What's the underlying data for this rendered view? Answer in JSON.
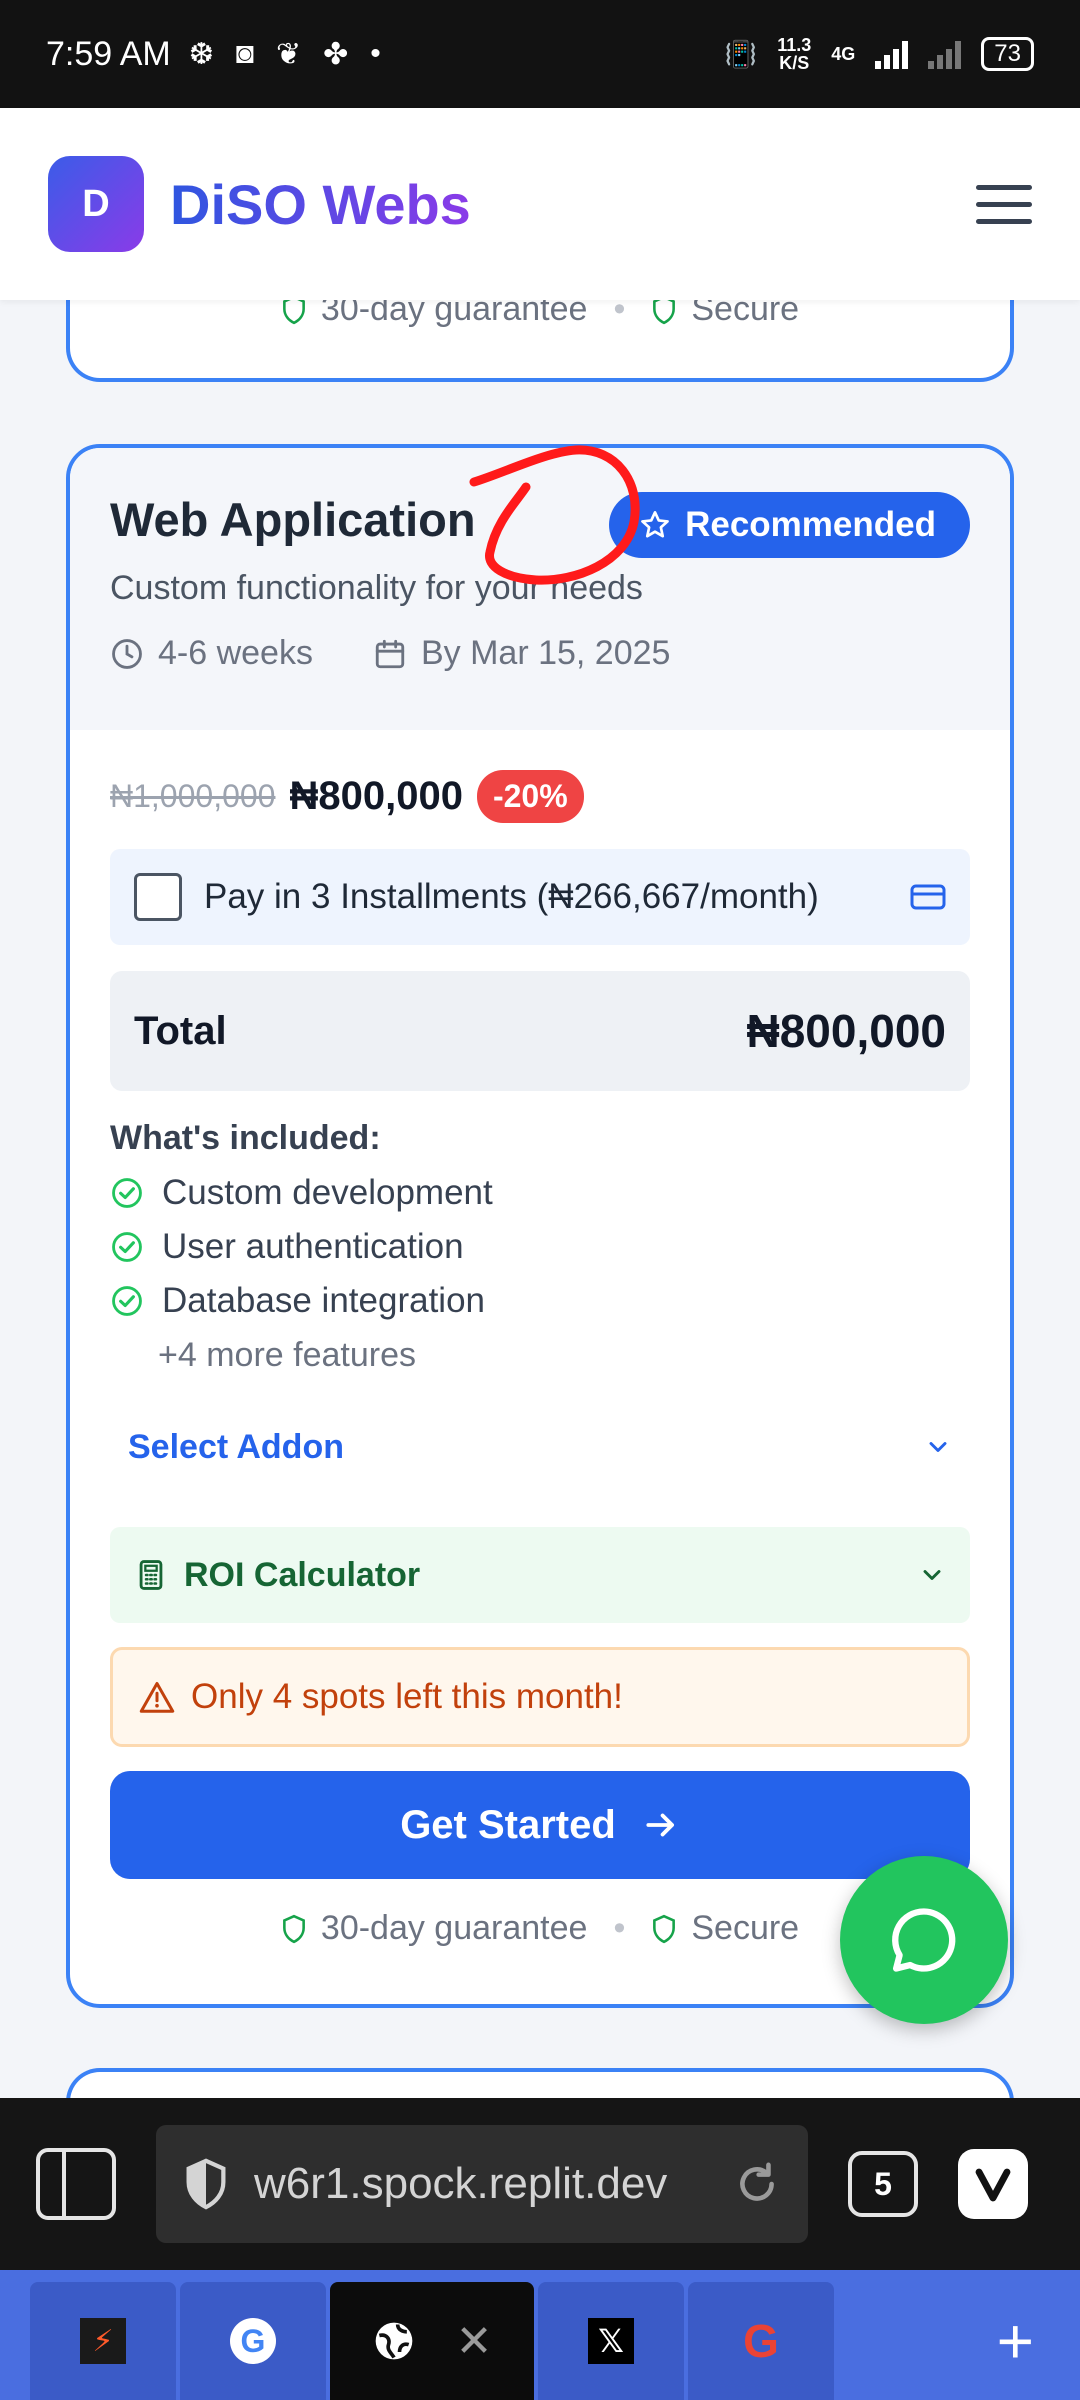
{
  "status_bar": {
    "time": "7:59 AM",
    "net_speed_value": "11.3",
    "net_speed_unit": "K/S",
    "network": "4G",
    "battery": "73"
  },
  "header": {
    "logo_letter": "D",
    "brand": "DiSO Webs"
  },
  "prev_card": {
    "guarantee": "30-day guarantee",
    "secure": "Secure"
  },
  "plan": {
    "title": "Web Application",
    "badge": "Recommended",
    "subtitle": "Custom functionality for your needs",
    "duration": "4-6 weeks",
    "delivery": "By Mar 15, 2025",
    "old_price": "₦1,000,000",
    "new_price": "₦800,000",
    "discount": "-20%",
    "installments_label": "Pay in 3 Installments (₦266,667/month)",
    "installments_checked": false,
    "total_label": "Total",
    "total_value": "₦800,000",
    "included_heading": "What's included:",
    "features": [
      "Custom development",
      "User authentication",
      "Database integration"
    ],
    "more_features": "+4 more features",
    "addon_label": "Select Addon",
    "roi_label": "ROI Calculator",
    "warning": "Only 4 spots left this month!",
    "cta": "Get Started",
    "guarantee": "30-day guarantee",
    "secure": "Secure"
  },
  "browser": {
    "url": "w6r1.spock.replit.dev",
    "tab_count": "5"
  },
  "colors": {
    "accent": "#2563eb",
    "card_border": "#3b82f6",
    "discount": "#ef4444",
    "success": "#22c55e",
    "warning": "#c2410c"
  }
}
